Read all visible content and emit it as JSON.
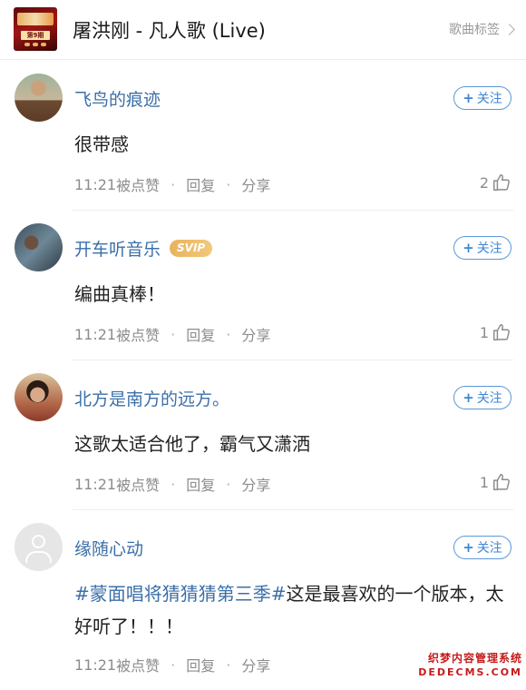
{
  "header": {
    "song_title": "屠洪刚 - 凡人歌 (Live)",
    "tag_link": "歌曲标签",
    "cover_badge": "第9期"
  },
  "actions": {
    "follow": "关注",
    "reply": "回复",
    "share": "分享",
    "separator": "·"
  },
  "comments": [
    {
      "nickname": "飞鸟的痕迹",
      "text": "很带感",
      "time": "11:21",
      "like_label": "被点赞",
      "likes": "2"
    },
    {
      "nickname": "开车听音乐",
      "badge": "SVIP",
      "text": "编曲真棒！",
      "time": "11:21",
      "like_label": "被点赞",
      "likes": "1"
    },
    {
      "nickname": "北方是南方的远方。",
      "text": "这歌太适合他了，霸气又潇洒",
      "time": "11:21",
      "like_label": "被点赞",
      "likes": "1"
    },
    {
      "nickname": "缘随心动",
      "topic": "#蒙面唱将猜猜猜第三季#",
      "text": "这是最喜欢的一个版本，太好听了！！！",
      "time": "11:21",
      "like_label": "被点赞"
    }
  ],
  "watermark": {
    "line1": "织梦内容管理系统",
    "line2": "DEDECMS.COM"
  },
  "colors": {
    "link_blue": "#3b6fa8",
    "follow_blue": "#3f86d4",
    "meta_gray": "#8c8c8c",
    "svip_gold": "#e9b25e"
  }
}
